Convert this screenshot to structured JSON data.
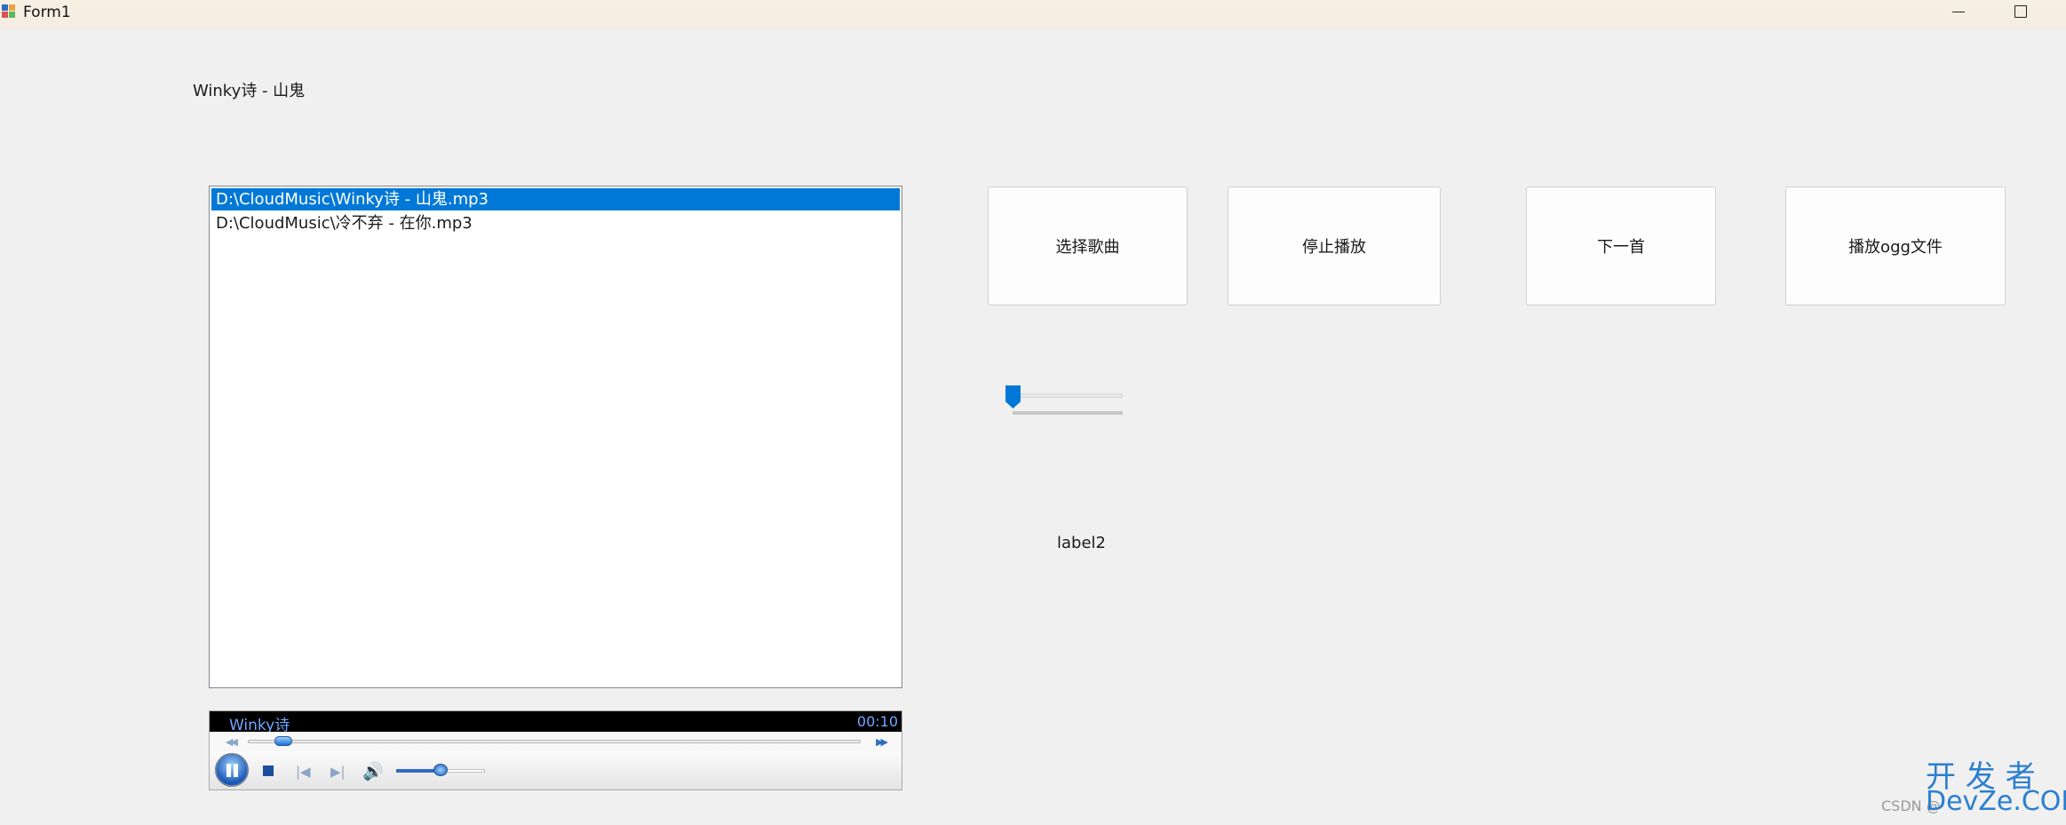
{
  "window": {
    "title": "Form1",
    "icon": "winforms-app-icon",
    "controls": [
      "minimize-icon",
      "maximize-icon"
    ]
  },
  "now_playing_label": "Winky诗 - 山鬼",
  "playlist": {
    "items": [
      {
        "path": "D:\\CloudMusic\\Winky诗 - 山鬼.mp3",
        "selected": true
      },
      {
        "path": "D:\\CloudMusic\\冷不弃 - 在你.mp3",
        "selected": false
      }
    ]
  },
  "buttons": {
    "select_song": "选择歌曲",
    "stop_play": "停止播放",
    "next_song": "下一首",
    "play_ogg": "播放ogg文件"
  },
  "trackbar": {
    "value": 0
  },
  "label2": "label2",
  "media_player": {
    "artist": "Winky诗",
    "time": "00:10",
    "seek_position": 0.05,
    "volume": 0.5,
    "state": "playing"
  },
  "watermark": {
    "brand_cn": "开 发 者",
    "brand_en": "DevZe.COM",
    "small": "CSDN @"
  },
  "colors": {
    "selection": "#0078d7",
    "wmp_text": "#6ea6ff",
    "watermark": "#2a7fcf"
  }
}
